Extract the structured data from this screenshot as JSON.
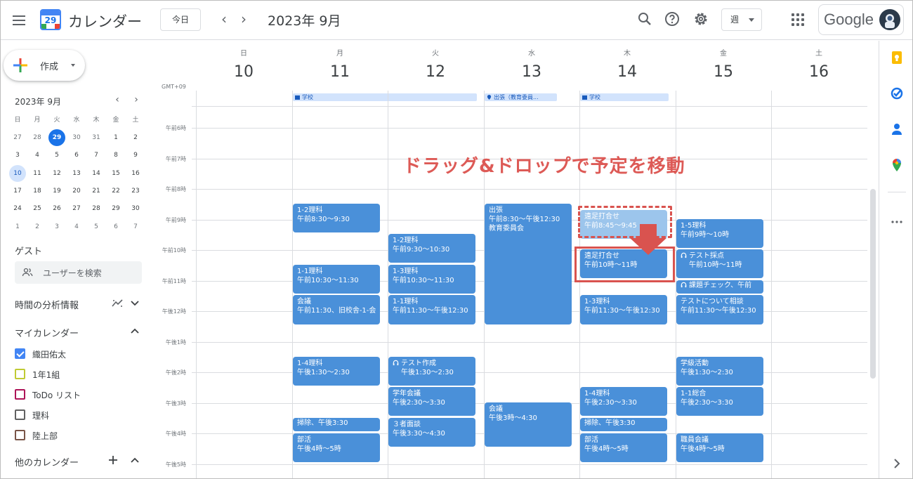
{
  "header": {
    "app_title": "カレンダー",
    "logo_day": "29",
    "today_label": "今日",
    "prev_label": "‹",
    "next_label": "›",
    "current_month": "2023年 9月",
    "view_label": "週",
    "account_logo": "Google",
    "icons": [
      "menu-icon",
      "search-icon",
      "help-icon",
      "settings-icon",
      "apps-icon"
    ]
  },
  "sidebar": {
    "create_label": "作成",
    "mini_calendar": {
      "title": "2023年 9月",
      "prev": "‹",
      "next": "›",
      "dow": [
        "日",
        "月",
        "火",
        "水",
        "木",
        "金",
        "土"
      ],
      "weeks": [
        [
          "27",
          "28",
          "29",
          "30",
          "31",
          "1",
          "2"
        ],
        [
          "3",
          "4",
          "5",
          "6",
          "7",
          "8",
          "9"
        ],
        [
          "10",
          "11",
          "12",
          "13",
          "14",
          "15",
          "16"
        ],
        [
          "17",
          "18",
          "19",
          "20",
          "21",
          "22",
          "23"
        ],
        [
          "24",
          "25",
          "26",
          "27",
          "28",
          "29",
          "30"
        ],
        [
          "1",
          "2",
          "3",
          "4",
          "5",
          "6",
          "7"
        ]
      ]
    },
    "guest_label": "ゲスト",
    "guest_search_placeholder": "ユーザーを検索",
    "analytics_label": "時間の分析情報",
    "my_calendars_label": "マイカレンダー",
    "my_calendars": [
      {
        "name": "織田佑太",
        "color": "#4285f4",
        "checked": true
      },
      {
        "name": "1年1組",
        "color": "#c0ca33",
        "checked": false
      },
      {
        "name": "ToDo リスト",
        "color": "#ad1457",
        "checked": false
      },
      {
        "name": "理科",
        "color": "#616161",
        "checked": false
      },
      {
        "name": "陸上部",
        "color": "#795548",
        "checked": false
      }
    ],
    "other_calendars_label": "他のカレンダー"
  },
  "week": {
    "days": [
      {
        "dow": "日",
        "num": "10"
      },
      {
        "dow": "月",
        "num": "11"
      },
      {
        "dow": "火",
        "num": "12"
      },
      {
        "dow": "水",
        "num": "13"
      },
      {
        "dow": "木",
        "num": "14"
      },
      {
        "dow": "金",
        "num": "15"
      },
      {
        "dow": "土",
        "num": "16"
      }
    ],
    "timezone": "GMT+09",
    "hours": [
      "午前6時",
      "午前7時",
      "午前8時",
      "午前9時",
      "午前10時",
      "午前11時",
      "午後12時",
      "午後1時",
      "午後2時",
      "午後3時",
      "午後4時",
      "午後5時"
    ],
    "allday": [
      {
        "label": "学校",
        "icon": "building-icon"
      },
      {
        "label": "出張（教育委員...",
        "icon": "location-icon"
      },
      {
        "label": "学校",
        "icon": "building-icon"
      }
    ]
  },
  "events": [
    {
      "title": "1-2理科",
      "time": "午前8:30～9:30"
    },
    {
      "title": "1-1理科",
      "time": "午前10:30～11:30"
    },
    {
      "title": "会議",
      "time": "午前11:30、旧校舎-1-会"
    },
    {
      "title": "1-4理科",
      "time": "午後1:30～2:30"
    },
    {
      "title": "掃除、午後3:30",
      "time": ""
    },
    {
      "title": "部活",
      "time": "午後4時～5時"
    },
    {
      "title": "1-2理科",
      "time": "午前9:30～10:30"
    },
    {
      "title": "1-3理科",
      "time": "午前10:30～11:30"
    },
    {
      "title": "1-1理科",
      "time": "午前11:30～午後12:30"
    },
    {
      "title": "テスト作成",
      "time": "午後1:30～2:30"
    },
    {
      "title": "学年会議",
      "time": "午後2:30～3:30"
    },
    {
      "title": "３者面談",
      "time": "午後3:30～4:30"
    },
    {
      "title": "出張",
      "time": "午前8:30～午後12:30",
      "extra": "教育委員会"
    },
    {
      "title": "会議",
      "time": "午後3時～4:30"
    },
    {
      "title": "遠足打合せ",
      "time": "午前8:45～9:45"
    },
    {
      "title": "遠足打合せ",
      "time": "午前10時～11時"
    },
    {
      "title": "1-3理科",
      "time": "午前11:30～午後12:30"
    },
    {
      "title": "1-4理科",
      "time": "午後2:30～3:30"
    },
    {
      "title": "掃除、午後3:30",
      "time": ""
    },
    {
      "title": "部活",
      "time": "午後4時～5時"
    },
    {
      "title": "1-5理科",
      "time": "午前9時～10時"
    },
    {
      "title": "テスト採点",
      "time": "午前10時～11時"
    },
    {
      "title": "課題チェック、午前",
      "time": ""
    },
    {
      "title": "テストについて相談",
      "time": "午前11:30～午後12:30"
    },
    {
      "title": "学級活動",
      "time": "午後1:30～2:30"
    },
    {
      "title": "1-1総合",
      "time": "午後2:30～3:30"
    },
    {
      "title": "職員会議",
      "time": "午後4時～5時"
    }
  ],
  "annotation": {
    "caption": "ドラッグ&ドロップで予定を移動",
    "color": "#dd5a56"
  },
  "colors": {
    "event": "#4a90d9",
    "ghost_event": "#9cc5ec",
    "today": "#1a73e8"
  }
}
